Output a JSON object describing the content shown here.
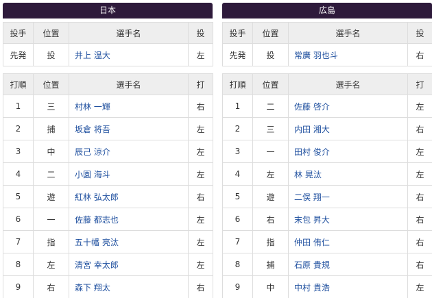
{
  "teams": [
    {
      "name": "日本",
      "pitcher_headers": [
        "投手",
        "位置",
        "選手名",
        "投"
      ],
      "pitcher": {
        "role": "先発",
        "pos": "投",
        "name": "井上 温大",
        "hand": "左"
      },
      "lineup_headers": [
        "打順",
        "位置",
        "選手名",
        "打"
      ],
      "lineup": [
        {
          "order": "1",
          "pos": "三",
          "name": "村林 一輝",
          "hand": "右"
        },
        {
          "order": "2",
          "pos": "捕",
          "name": "坂倉 将吾",
          "hand": "左"
        },
        {
          "order": "3",
          "pos": "中",
          "name": "辰己 涼介",
          "hand": "左"
        },
        {
          "order": "4",
          "pos": "二",
          "name": "小園 海斗",
          "hand": "左"
        },
        {
          "order": "5",
          "pos": "遊",
          "name": "紅林 弘太郎",
          "hand": "右"
        },
        {
          "order": "6",
          "pos": "一",
          "name": "佐藤 都志也",
          "hand": "左"
        },
        {
          "order": "7",
          "pos": "指",
          "name": "五十幡 亮汰",
          "hand": "左"
        },
        {
          "order": "8",
          "pos": "左",
          "name": "清宮 幸太郎",
          "hand": "左"
        },
        {
          "order": "9",
          "pos": "右",
          "name": "森下 翔太",
          "hand": "右"
        }
      ]
    },
    {
      "name": "広島",
      "pitcher_headers": [
        "投手",
        "位置",
        "選手名",
        "投"
      ],
      "pitcher": {
        "role": "先発",
        "pos": "投",
        "name": "常廣 羽也斗",
        "hand": "右"
      },
      "lineup_headers": [
        "打順",
        "位置",
        "選手名",
        "打"
      ],
      "lineup": [
        {
          "order": "1",
          "pos": "二",
          "name": "佐藤 啓介",
          "hand": "左"
        },
        {
          "order": "2",
          "pos": "三",
          "name": "内田 湘大",
          "hand": "右"
        },
        {
          "order": "3",
          "pos": "一",
          "name": "田村 俊介",
          "hand": "左"
        },
        {
          "order": "4",
          "pos": "左",
          "name": "林 晃汰",
          "hand": "左"
        },
        {
          "order": "5",
          "pos": "遊",
          "name": "二俣 翔一",
          "hand": "右"
        },
        {
          "order": "6",
          "pos": "右",
          "name": "末包 昇大",
          "hand": "右"
        },
        {
          "order": "7",
          "pos": "指",
          "name": "仲田 侑仁",
          "hand": "右"
        },
        {
          "order": "8",
          "pos": "捕",
          "name": "石原 貴規",
          "hand": "右"
        },
        {
          "order": "9",
          "pos": "中",
          "name": "中村 貴浩",
          "hand": "左"
        }
      ]
    }
  ]
}
